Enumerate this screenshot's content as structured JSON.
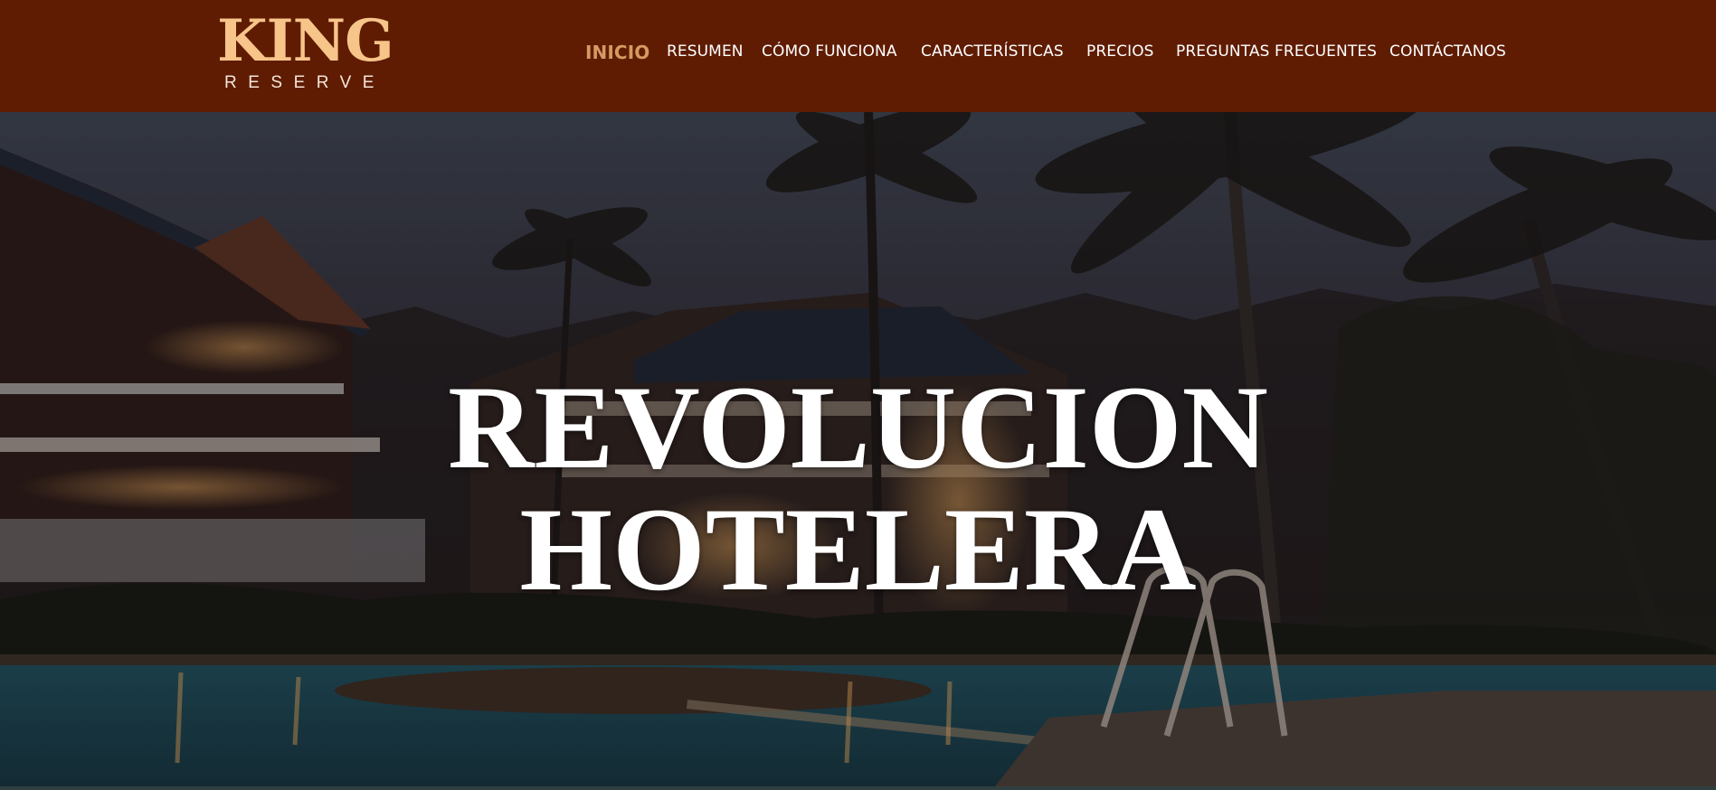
{
  "brand": {
    "name": "KING",
    "tagline": "RESERVE",
    "accent_color": "#f7c48a",
    "header_color": "#5f1c03"
  },
  "nav": {
    "items": [
      {
        "label": "INICIO",
        "active": true
      },
      {
        "label": "RESUMEN",
        "active": false
      },
      {
        "label": "CÓMO FUNCIONA",
        "active": false
      },
      {
        "label": "CARACTERÍSTICAS",
        "active": false
      },
      {
        "label": "PRECIOS",
        "active": false
      },
      {
        "label": "PREGUNTAS FRECUENTES",
        "active": false
      },
      {
        "label": "CONTÁCTANOS",
        "active": false
      }
    ],
    "active_color": "#d59a64"
  },
  "hero": {
    "title_line1": "REVOLUCION",
    "title_line2": "HOTELERA",
    "background_image": "night-resort-pool-palms"
  }
}
